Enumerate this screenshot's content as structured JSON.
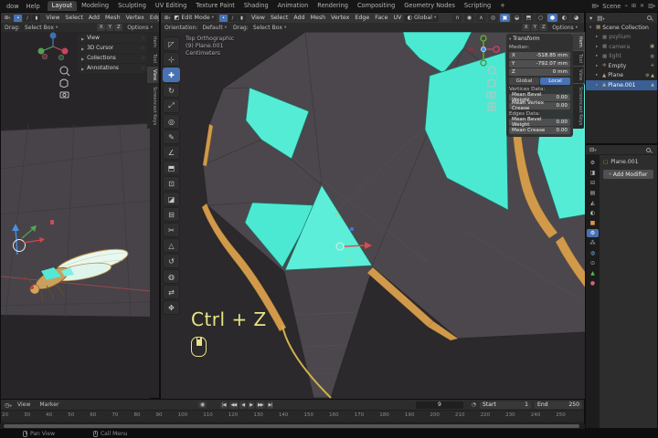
{
  "colors": {
    "accent_blue": "#4772b3",
    "selected_face_cyan": "#4ce9d2",
    "vein_orange": "#d1994a",
    "mesh_gray": "#4b474c",
    "screencast_yellow": "#e9e388",
    "outliner_select": "#3a5f96"
  },
  "topbar": {
    "window_menu_partial": "dow",
    "help_menu": "Help",
    "workspaces": [
      {
        "label": "Layout",
        "active": true
      },
      {
        "label": "Modeling"
      },
      {
        "label": "Sculpting"
      },
      {
        "label": "UV Editing"
      },
      {
        "label": "Texture Paint"
      },
      {
        "label": "Shading"
      },
      {
        "label": "Animation"
      },
      {
        "label": "Rendering"
      },
      {
        "label": "Compositing"
      },
      {
        "label": "Geometry Nodes"
      },
      {
        "label": "Scripting"
      },
      {
        "label": "+"
      }
    ],
    "scene_label": "Scene"
  },
  "viewport_shared": {
    "menus": [
      "View",
      "Select",
      "Add",
      "Mesh",
      "Vertex",
      "Edge",
      "Face",
      "UV"
    ],
    "drag_label": "Drag:",
    "drag_tool": "Select Box",
    "mirror_axes": [
      "X",
      "Y",
      "Z"
    ],
    "options_label": "Options"
  },
  "left_viewport": {
    "npanel_sections": [
      {
        "label": "View"
      },
      {
        "label": "3D Cursor"
      },
      {
        "label": "Collections"
      },
      {
        "label": "Annotations"
      }
    ],
    "sidebar_tabs": [
      {
        "label": "Item",
        "name": "tab-item"
      },
      {
        "label": "Tool",
        "name": "tab-tool"
      },
      {
        "label": "View",
        "active": true,
        "name": "tab-view"
      },
      {
        "label": "Screencast Keys",
        "name": "tab-screencast-keys"
      }
    ]
  },
  "main_viewport": {
    "mode": "Edit Mode",
    "orientation_pill": "Global",
    "orientation_label": "Orientation:",
    "orientation_value": "Default",
    "info_lines": [
      {
        "label": "Top Orthographic"
      },
      {
        "label": "(9) Plane.001"
      },
      {
        "label": "Centimeters"
      }
    ],
    "screencast_keys": "Ctrl + Z",
    "header_icons": [
      {
        "name": "magnet-snap-icon",
        "glyph": "∩"
      },
      {
        "name": "proportional-editing-icon",
        "glyph": "◉"
      },
      {
        "name": "falloff-icon",
        "glyph": "∧"
      },
      {
        "name": "pivot-point-icon",
        "glyph": "◎"
      },
      {
        "name": "gizmo-toggle-icon",
        "glyph": "▣",
        "active": true
      },
      {
        "name": "overlays-icon",
        "glyph": "◒"
      },
      {
        "name": "xray-toggle-icon",
        "glyph": "⬒"
      },
      {
        "name": "shading-wireframe-icon",
        "glyph": "○"
      },
      {
        "name": "shading-solid-icon",
        "glyph": "●",
        "active": true
      },
      {
        "name": "shading-material-icon",
        "glyph": "◐"
      },
      {
        "name": "shading-rendered-icon",
        "glyph": "◕"
      }
    ],
    "toolbar": [
      {
        "name": "select-box-tool",
        "glyph": "◸"
      },
      {
        "name": "cursor-tool",
        "glyph": "⊹"
      },
      {
        "name": "move-tool",
        "glyph": "✚",
        "active": true
      },
      {
        "name": "rotate-tool",
        "glyph": "↻"
      },
      {
        "name": "scale-tool",
        "glyph": "⤢"
      },
      {
        "name": "transform-tool",
        "glyph": "◎"
      },
      {
        "name": "annotate-tool",
        "glyph": "✎"
      },
      {
        "name": "measure-tool",
        "glyph": "∠"
      },
      {
        "name": "extrude-region-tool",
        "glyph": "⬒"
      },
      {
        "name": "inset-faces-tool",
        "glyph": "⊡"
      },
      {
        "name": "bevel-tool",
        "glyph": "◪"
      },
      {
        "name": "loop-cut-tool",
        "glyph": "⊟"
      },
      {
        "name": "knife-tool",
        "glyph": "✂"
      },
      {
        "name": "poly-build-tool",
        "glyph": "△"
      },
      {
        "name": "spin-tool",
        "glyph": "↺"
      },
      {
        "name": "smooth-tool",
        "glyph": "◍"
      },
      {
        "name": "edge-slide-tool",
        "glyph": "⇄"
      },
      {
        "name": "shrink-fatten-tool",
        "glyph": "✥"
      }
    ],
    "npanel": {
      "title": "Transform",
      "median_label": "Median:",
      "median": [
        {
          "axis": "X",
          "value": "-518.85 mm"
        },
        {
          "axis": "Y",
          "value": "-792.07 mm"
        },
        {
          "axis": "Z",
          "value": "0 mm"
        }
      ],
      "space_buttons": [
        {
          "label": "Global"
        },
        {
          "label": "Local",
          "active": true
        }
      ],
      "vertices_data_label": "Vertices Data:",
      "vertex_fields": [
        {
          "label": "Mean Bevel Weight",
          "value": "0.00"
        },
        {
          "label": "Mean Vertex Crease",
          "value": "0.00"
        }
      ],
      "edges_data_label": "Edges Data:",
      "edge_fields": [
        {
          "label": "Mean Bevel Weight",
          "value": "0.00"
        },
        {
          "label": "Mean Crease",
          "value": "0.00"
        }
      ]
    },
    "sidebar_tabs": [
      {
        "label": "Item",
        "active": true,
        "name": "tab-item"
      },
      {
        "label": "Tool",
        "name": "tab-tool"
      },
      {
        "label": "View",
        "name": "tab-view"
      },
      {
        "label": "Screencast Keys",
        "name": "tab-screencast-keys"
      }
    ]
  },
  "outliner": {
    "rows": [
      {
        "label": "Scene Collection",
        "exp": "▾",
        "icon": "▦",
        "right": ""
      },
      {
        "label": "psylium",
        "exp": "▸",
        "icon": "▦",
        "dim": true,
        "child": true,
        "right": ""
      },
      {
        "label": "camera",
        "exp": "▸",
        "icon": "▦",
        "dim": true,
        "child": true,
        "right": "▣"
      },
      {
        "label": "light",
        "exp": "▸",
        "icon": "▦",
        "dim": true,
        "child": true,
        "right": "◍"
      },
      {
        "label": "Empty",
        "exp": "▸",
        "icon": "✛",
        "child": true,
        "right": "✛"
      },
      {
        "label": "Plane",
        "exp": "▸",
        "icon": "▲",
        "child": true,
        "right": "⚙ ▲"
      },
      {
        "label": "Plane.001",
        "exp": "▸",
        "icon": "▲",
        "child": true,
        "selected": true,
        "right": "▲"
      }
    ]
  },
  "properties": {
    "breadcrumb": "Plane.001",
    "add_modifier_label": "Add Modifier",
    "tabs": [
      {
        "name": "tool-tab",
        "glyph": "⚙",
        "color": "#b8b8b8"
      },
      {
        "name": "render-tab",
        "glyph": "◨",
        "color": "#b8b8b8"
      },
      {
        "name": "output-tab",
        "glyph": "⊟",
        "color": "#b8b8b8"
      },
      {
        "name": "view-layer-tab",
        "glyph": "▤",
        "color": "#b8b8b8"
      },
      {
        "name": "scene-tab",
        "glyph": "◭",
        "color": "#b8b8b8"
      },
      {
        "name": "world-tab",
        "glyph": "◐",
        "color": "#b8b8b8"
      },
      {
        "name": "object-tab",
        "glyph": "■",
        "color": "#e0914a"
      },
      {
        "name": "modifiers-tab",
        "glyph": "⚙",
        "active": true
      },
      {
        "name": "particles-tab",
        "glyph": "⁂",
        "color": "#b8b8b8"
      },
      {
        "name": "physics-tab",
        "glyph": "◍",
        "color": "#6aa1e0"
      },
      {
        "name": "constraints-tab",
        "glyph": "⊙",
        "color": "#b8b8b8"
      },
      {
        "name": "object-data-tab",
        "glyph": "▲",
        "color": "#5cb85c"
      },
      {
        "name": "material-tab",
        "glyph": "●",
        "color": "#d06a6a"
      }
    ]
  },
  "timeline": {
    "menus": [
      {
        "label": "View"
      },
      {
        "label": "Marker"
      }
    ],
    "transport": [
      {
        "name": "jump-to-start-button",
        "glyph": "|◀"
      },
      {
        "name": "prev-keyframe-button",
        "glyph": "◀◀"
      },
      {
        "name": "play-reverse-button",
        "glyph": "◀"
      },
      {
        "name": "play-button",
        "glyph": "▶"
      },
      {
        "name": "next-keyframe-button",
        "glyph": "▶▶"
      },
      {
        "name": "jump-to-end-button",
        "glyph": "▶|"
      }
    ],
    "record_glyph": "◉",
    "current_frame": "9",
    "start_label": "Start",
    "start_value": "1",
    "end_label": "End",
    "end_value": "250",
    "ticks": [
      {
        "label": "20"
      },
      {
        "label": "30"
      },
      {
        "label": "40"
      },
      {
        "label": "50"
      },
      {
        "label": "60"
      },
      {
        "label": "70"
      },
      {
        "label": "80"
      },
      {
        "label": "90"
      },
      {
        "label": "100"
      },
      {
        "label": "110"
      },
      {
        "label": "120"
      },
      {
        "label": "130"
      },
      {
        "label": "140"
      },
      {
        "label": "150"
      },
      {
        "label": "160"
      },
      {
        "label": "170"
      },
      {
        "label": "180"
      },
      {
        "label": "190"
      },
      {
        "label": "200"
      },
      {
        "label": "210"
      },
      {
        "label": "220"
      },
      {
        "label": "230"
      },
      {
        "label": "240"
      },
      {
        "label": "250"
      }
    ]
  },
  "statusbar": {
    "items": [
      {
        "label": "Pan View"
      },
      {
        "label": "Call Menu"
      }
    ]
  }
}
